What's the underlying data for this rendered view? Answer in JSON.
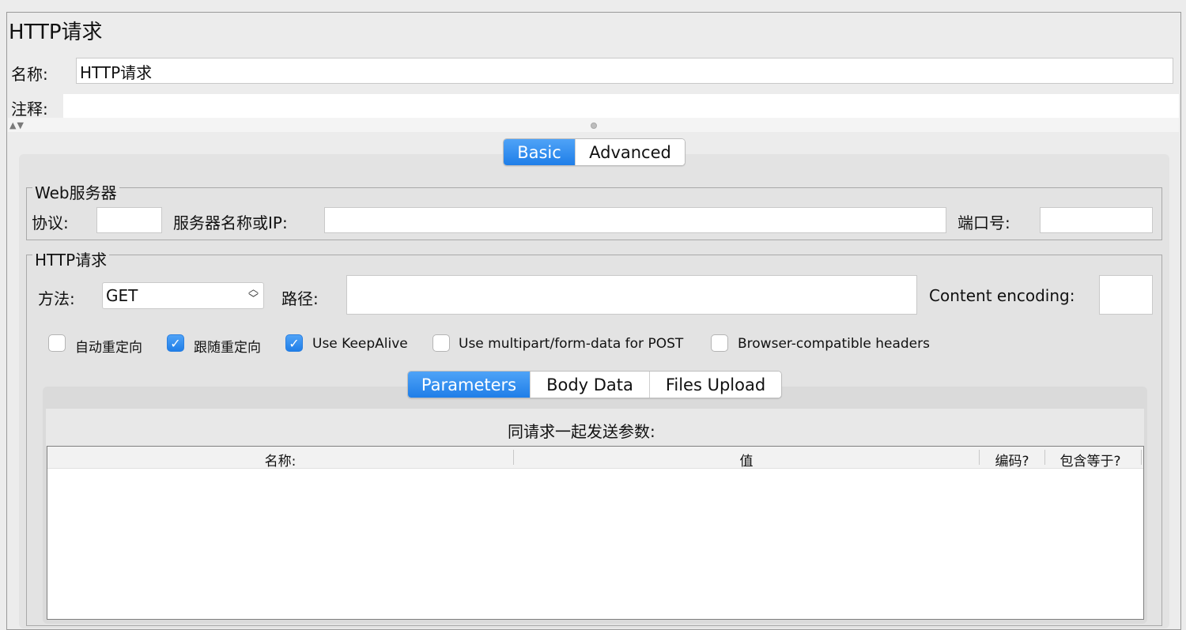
{
  "window": {
    "title": "HTTP请求"
  },
  "name_field": {
    "label": "名称:",
    "value": "HTTP请求"
  },
  "comment_field": {
    "label": "注释:",
    "value": ""
  },
  "splitter": {
    "arrows": "▲▼"
  },
  "main_tabs": [
    {
      "label": "Basic",
      "active": true
    },
    {
      "label": "Advanced",
      "active": false
    }
  ],
  "web_server": {
    "title": "Web服务器",
    "protocol_label": "协议:",
    "protocol_value": "",
    "server_label": "服务器名称或IP:",
    "server_value": "",
    "port_label": "端口号:",
    "port_value": ""
  },
  "http_request": {
    "title": "HTTP请求",
    "method_label": "方法:",
    "method_value": "GET",
    "path_label": "路径:",
    "path_value": "",
    "encoding_label": "Content encoding:",
    "encoding_value": ""
  },
  "options": [
    {
      "label": "自动重定向",
      "checked": false
    },
    {
      "label": "跟随重定向",
      "checked": true
    },
    {
      "label": "Use KeepAlive",
      "checked": true
    },
    {
      "label": "Use multipart/form-data for POST",
      "checked": false
    },
    {
      "label": "Browser-compatible headers",
      "checked": false
    }
  ],
  "sub_tabs": [
    {
      "label": "Parameters",
      "active": true
    },
    {
      "label": "Body Data",
      "active": false
    },
    {
      "label": "Files Upload",
      "active": false
    }
  ],
  "parameters": {
    "title": "同请求一起发送参数:",
    "columns": [
      "名称:",
      "值",
      "编码?",
      "包含等于?"
    ],
    "rows": []
  },
  "colors": {
    "accent": "#2a86ee",
    "panel": "#e3e3e3",
    "background": "#ececec"
  },
  "icons": {
    "checkmark": "check-icon",
    "select_arrows": "updown-chevron-icon"
  }
}
